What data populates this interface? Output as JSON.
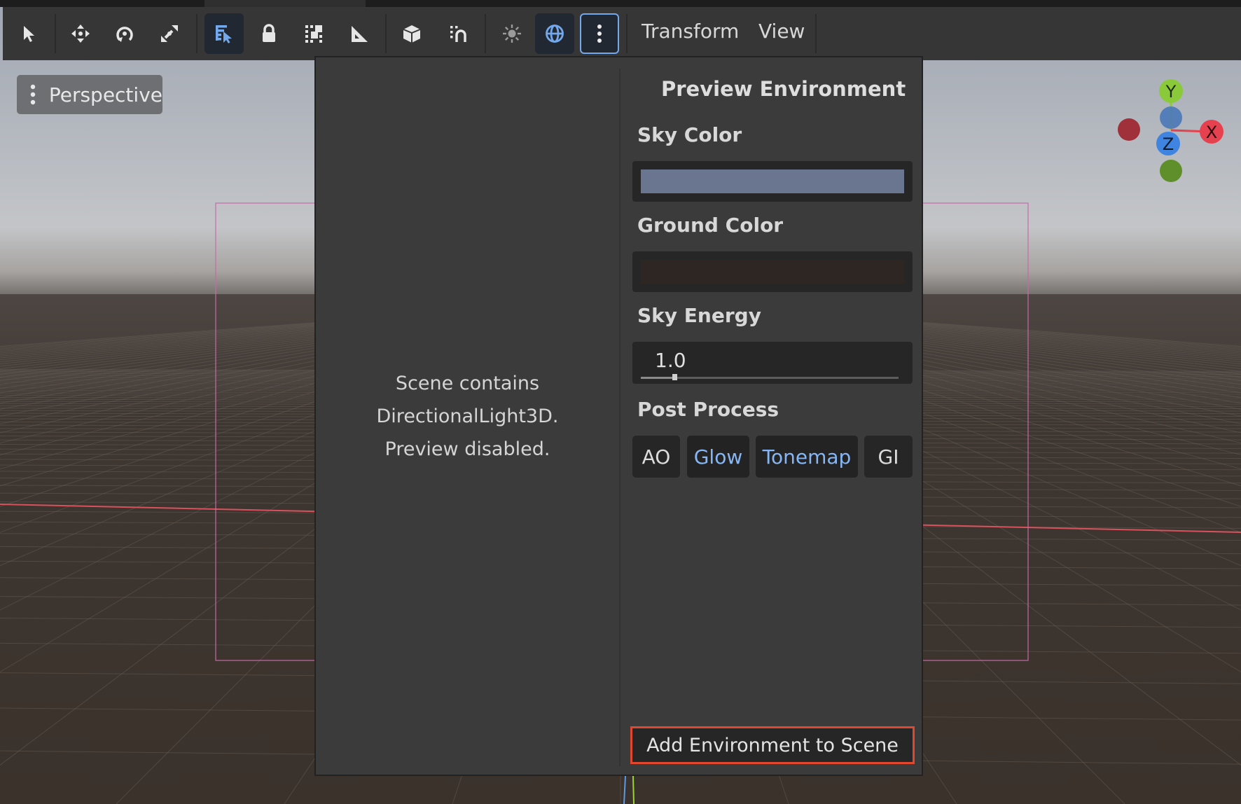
{
  "toolbar": {
    "tools": [
      {
        "name": "select-tool",
        "icon": "cursor-arrow-icon",
        "active": false
      },
      {
        "name": "move-tool",
        "icon": "move-arrows-icon",
        "active": false
      },
      {
        "name": "rotate-tool",
        "icon": "rotate-icon",
        "active": false
      },
      {
        "name": "scale-tool",
        "icon": "scale-icon",
        "active": false
      },
      {
        "name": "list-select-tool",
        "icon": "list-select-icon",
        "active": true
      },
      {
        "name": "lock-tool",
        "icon": "lock-icon",
        "active": false
      },
      {
        "name": "group-tool",
        "icon": "group-icon",
        "active": false
      },
      {
        "name": "ruler-tool",
        "icon": "ruler-icon",
        "active": false
      },
      {
        "name": "local-space-tool",
        "icon": "cube-icon",
        "active": false
      },
      {
        "name": "snap-tool",
        "icon": "magnet-icon",
        "active": false
      },
      {
        "name": "preview-sun-toggle",
        "icon": "sun-icon",
        "active": false
      },
      {
        "name": "preview-environment-toggle",
        "icon": "globe-icon",
        "active": true
      },
      {
        "name": "environment-options-button",
        "icon": "kebab-menu-icon",
        "active": true
      }
    ],
    "menus": [
      "Transform",
      "View"
    ]
  },
  "viewport": {
    "perspective_label": "Perspective",
    "gizmo": {
      "y": "Y",
      "x": "X",
      "z": "Z"
    }
  },
  "popup": {
    "preview_message": [
      "Scene contains",
      "DirectionalLight3D.",
      "Preview disabled."
    ],
    "title": "Preview Environment",
    "sky_color_label": "Sky Color",
    "sky_color": "#6a7590",
    "ground_color_label": "Ground Color",
    "ground_color": "#2d2622",
    "sky_energy_label": "Sky Energy",
    "sky_energy_value": "1.0",
    "sky_energy_fraction": 0.13,
    "post_process_label": "Post Process",
    "post_process_buttons": [
      {
        "label": "AO",
        "on": false
      },
      {
        "label": "Glow",
        "on": true
      },
      {
        "label": "Tonemap",
        "on": true
      },
      {
        "label": "GI",
        "on": false
      }
    ],
    "add_environment_label": "Add Environment to Scene"
  },
  "colors": {
    "accent": "#73a8ec",
    "highlight_border": "#e0472c",
    "x_axis": "#e5414f",
    "y_axis": "#8ac93a",
    "z_axis": "#3e84e0"
  }
}
